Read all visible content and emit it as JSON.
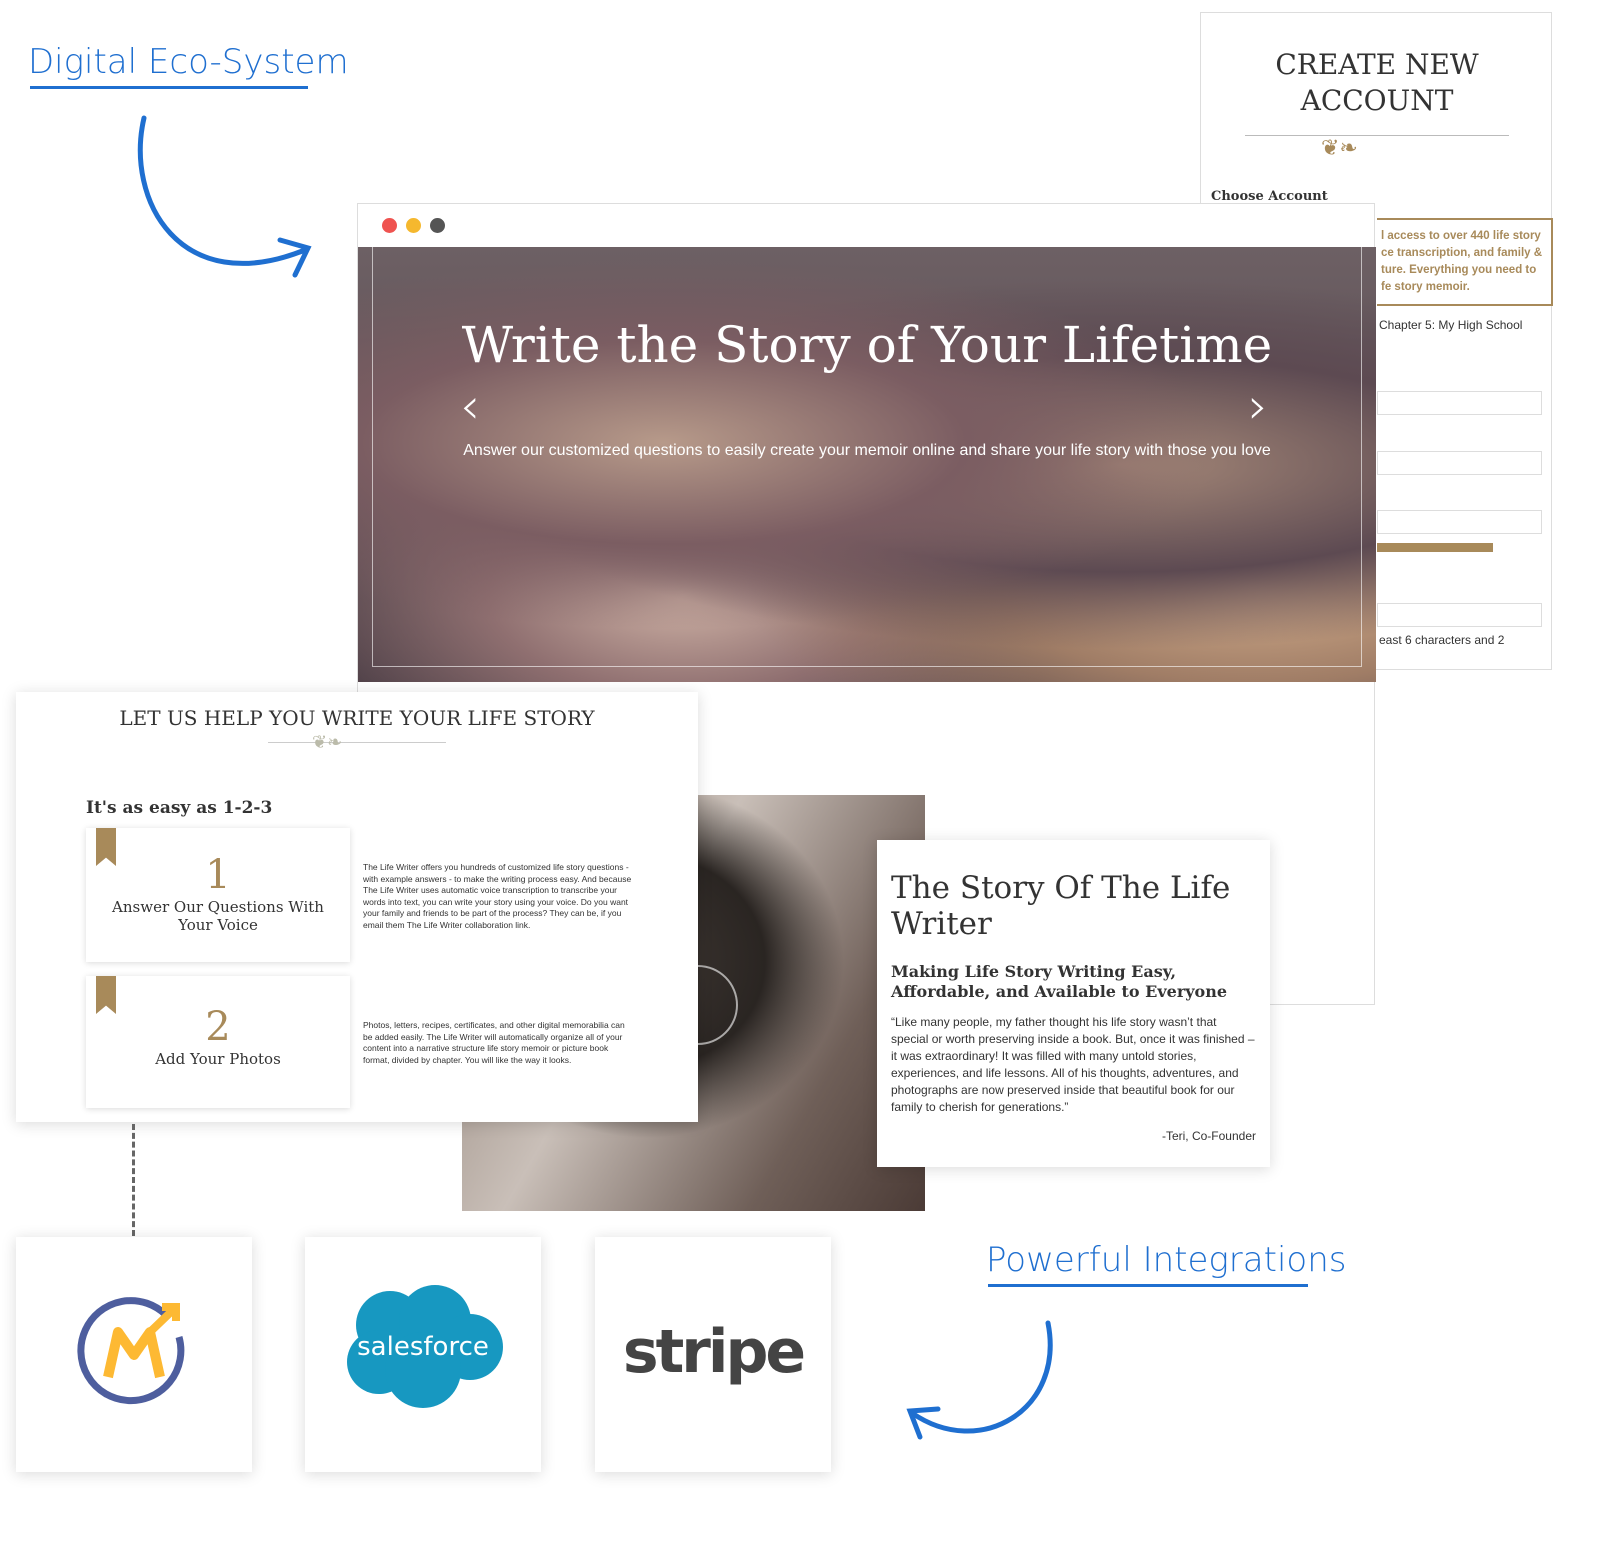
{
  "labels": {
    "ecosystem": "Digital Eco-System",
    "integrations": "Powerful Integrations"
  },
  "colors": {
    "accent_blue": "#1f6fd0",
    "gold": "#a88a5a"
  },
  "account": {
    "title": "CREATE NEW ACCOUNT",
    "choose": "Choose Account",
    "promo": "l access to over 440 life story ce transcription, and family & ture. Everything you need to fe story memoir.",
    "chapter": "Chapter 5: My High School",
    "hint": "east 6 characters and 2"
  },
  "hero": {
    "title": "Write the Story of Your Lifetime",
    "subtitle": "Answer our customized questions to easily create your memoir online and share your life story with those you love"
  },
  "help": {
    "title": "LET US HELP YOU WRITE YOUR LIFE STORY",
    "subtitle": "It's as easy as 1-2-3",
    "steps": [
      {
        "num": "1",
        "label": "Answer Our Questions With Your Voice",
        "desc": "The Life Writer offers you hundreds of customized life story questions - with example answers - to make the writing process easy. And because The Life Writer uses automatic voice transcription to transcribe your words into text, you can write your story using your voice. Do you want your family and friends to be part of the process? They can be, if you email them The Life Writer collaboration link."
      },
      {
        "num": "2",
        "label": "Add Your Photos",
        "desc": "Photos, letters, recipes, certificates, and other digital memorabilia can be added easily. The Life Writer will automatically organize all of your content into a narrative structure life story memoir or picture book format, divided by chapter. You will like the way it looks."
      }
    ]
  },
  "story": {
    "title": "The Story Of The Life Writer",
    "subtitle": "Making Life Story Writing Easy, Affordable, and Available to Everyone",
    "quote": "“Like many people, my father thought his life story wasn’t that special or worth preserving inside a book. But, once it was finished – it was extraordinary! It was filled with many untold stories, experiences, and life lessons. All of his thoughts, adventures, and photographs are now preserved inside that beautiful book for our family to cherish for generations.”",
    "author": "-Teri, Co-Founder"
  },
  "logos": {
    "mautic": "M",
    "salesforce": "salesforce",
    "stripe": "stripe"
  }
}
